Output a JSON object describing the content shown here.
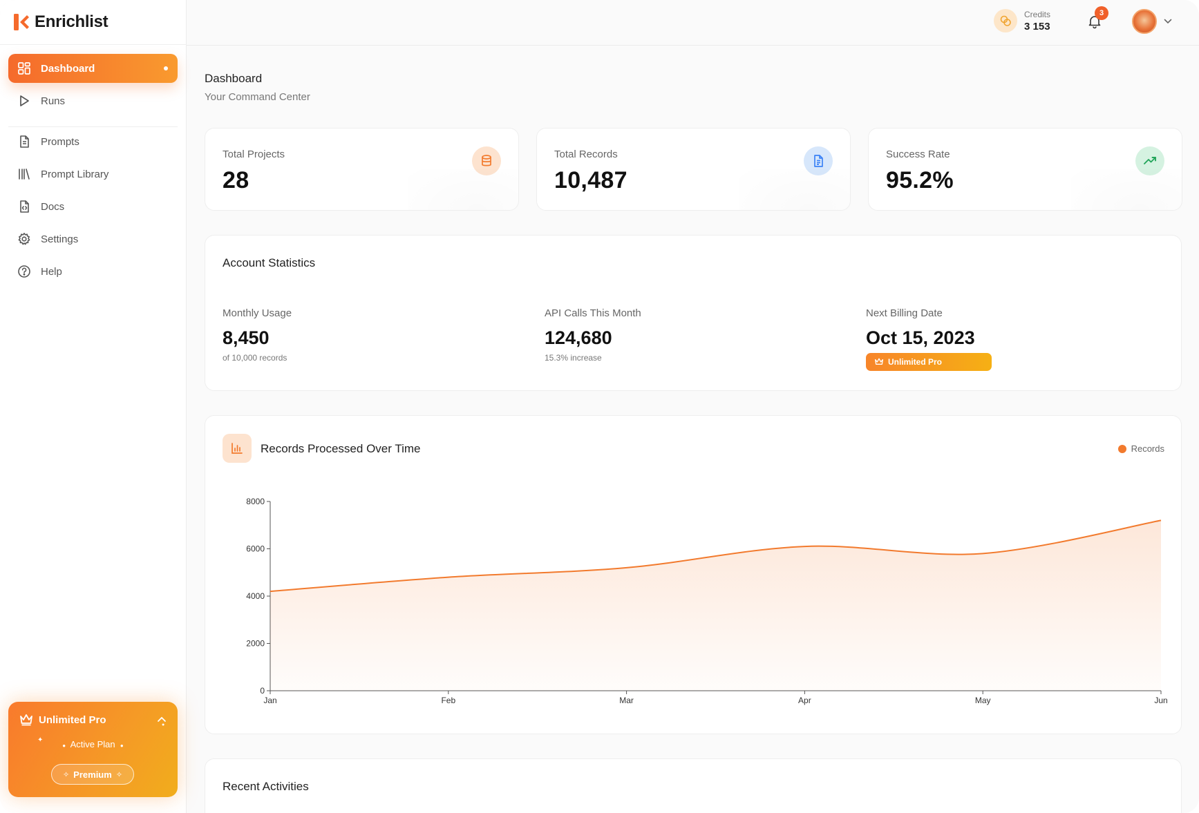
{
  "brand": {
    "name": "Enrichlist",
    "accent": "#f56a2c"
  },
  "sidebar": {
    "items": [
      {
        "label": "Dashboard",
        "icon": "dashboard-grid-icon",
        "active": true
      },
      {
        "label": "Runs",
        "icon": "play-icon"
      },
      {
        "label": "Prompts",
        "icon": "document-icon"
      },
      {
        "label": "Prompt Library",
        "icon": "library-icon"
      },
      {
        "label": "Docs",
        "icon": "code-file-icon"
      },
      {
        "label": "Settings",
        "icon": "gear-icon"
      },
      {
        "label": "Help",
        "icon": "help-circle-icon"
      }
    ],
    "plan": {
      "title": "Unlimited Pro",
      "status": "Active Plan",
      "button": "Premium"
    }
  },
  "topbar": {
    "credits_label": "Credits",
    "credits_value": "3 153",
    "notification_count": "3"
  },
  "page": {
    "title": "Dashboard",
    "subtitle": "Your Command Center"
  },
  "stats": [
    {
      "label": "Total Projects",
      "value": "28",
      "icon": "database-icon",
      "color": "#f27a2d",
      "bg": "#fde3cf"
    },
    {
      "label": "Total Records",
      "value": "10,487",
      "icon": "file-text-icon",
      "color": "#3b82f6",
      "bg": "#d7e7fb"
    },
    {
      "label": "Success Rate",
      "value": "95.2%",
      "icon": "trending-up-icon",
      "color": "#22a55a",
      "bg": "#d5f2e1"
    }
  ],
  "account": {
    "title": "Account Statistics",
    "monthly_usage": {
      "label": "Monthly Usage",
      "value": "8,450",
      "note": "of 10,000 records"
    },
    "api_calls": {
      "label": "API Calls This Month",
      "value": "124,680",
      "note": "15.3% increase"
    },
    "billing": {
      "label": "Next Billing Date",
      "value": "Oct 15, 2023",
      "badge": "Unlimited Pro"
    }
  },
  "chart": {
    "title": "Records Processed Over Time",
    "legend": "Records",
    "icon": "bar-chart-icon"
  },
  "chart_data": {
    "type": "area",
    "categories": [
      "Jan",
      "Feb",
      "Mar",
      "Apr",
      "May",
      "Jun"
    ],
    "series": [
      {
        "name": "Records",
        "values": [
          4200,
          4800,
          5200,
          6100,
          5800,
          7200
        ],
        "color": "#f27a2d"
      }
    ],
    "ylim": [
      0,
      8000
    ],
    "yticks": [
      0,
      2000,
      4000,
      6000,
      8000
    ],
    "grid": false,
    "legend_position": "top-right"
  },
  "recent": {
    "title": "Recent Activities"
  }
}
